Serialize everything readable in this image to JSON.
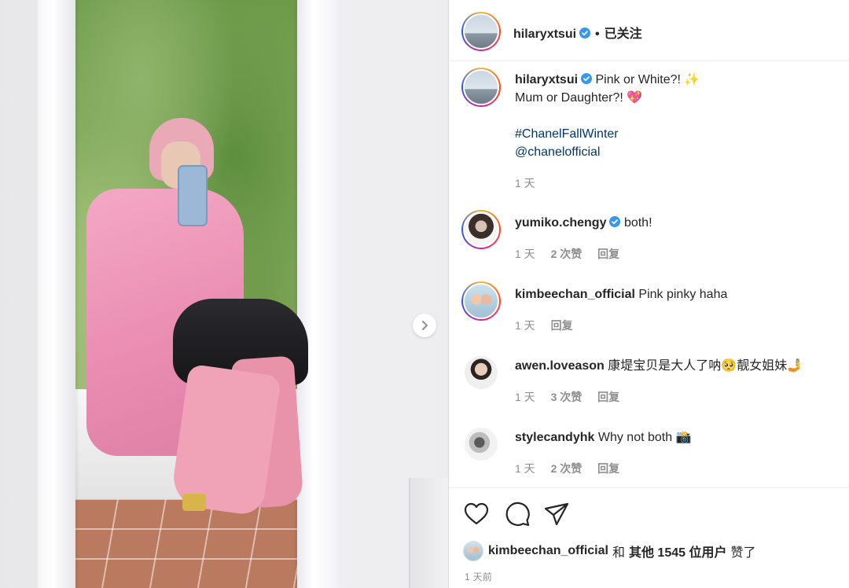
{
  "post": {
    "author": "hilaryxtsui",
    "follow_status": "已关注",
    "separator": "•",
    "caption_line1": "Pink or White?! ✨",
    "caption_line2": "Mum or Daughter?! 💖",
    "hashtag": "#ChanelFallWinter",
    "mention": "@chanelofficial",
    "caption_time": "1 天"
  },
  "comments": [
    {
      "user": "yumiko.chengy",
      "verified": true,
      "text": "both!",
      "time": "1 天",
      "likes": "2 次赞",
      "reply": "回复",
      "avatar": "yumiko-avatar"
    },
    {
      "user": "kimbeechan_official",
      "verified": false,
      "text": "Pink pinky haha",
      "time": "1 天",
      "likes": "",
      "reply": "回复",
      "avatar": "kimbee-avatar"
    },
    {
      "user": "awen.loveason",
      "verified": false,
      "text": "康堤宝贝是大人了呐🥺靓女姐妹🤳",
      "time": "1 天",
      "likes": "3 次赞",
      "reply": "回复",
      "avatar": "awen-avatar"
    },
    {
      "user": "stylecandyhk",
      "verified": false,
      "text": "Why not both 📸",
      "time": "1 天",
      "likes": "2 次赞",
      "reply": "回复",
      "avatar": "style-avatar"
    }
  ],
  "actions": {
    "icons": [
      "heart-icon",
      "comment-icon",
      "share-icon"
    ]
  },
  "liked_by": {
    "user": "kimbeechan_official",
    "joiner": "和",
    "others": "其他 1545 位用户",
    "suffix": "赞了"
  },
  "posted_ago": "1 天前",
  "colors": {
    "verified_blue": "#3897f0",
    "link_blue": "#00376b",
    "muted_gray": "#8e8e8e",
    "text": "#262626"
  }
}
